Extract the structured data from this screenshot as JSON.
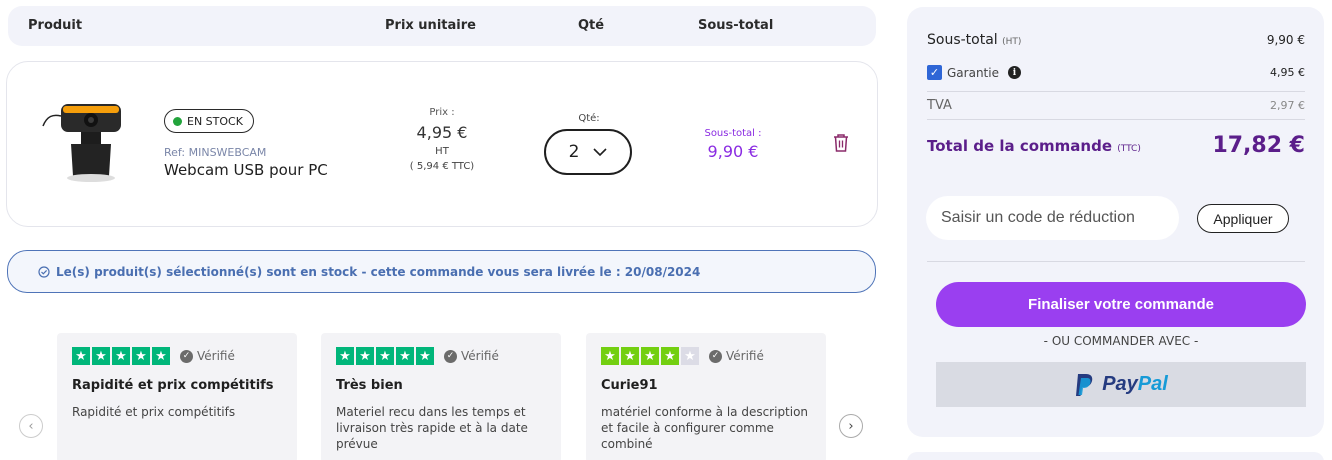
{
  "table_header": {
    "product": "Produit",
    "unit_price": "Prix unitaire",
    "qty": "Qté",
    "subtotal": "Sous-total"
  },
  "product": {
    "stock_badge": "EN STOCK",
    "ref": "Ref: MINSWEBCAM",
    "name": "Webcam USB pour PC",
    "price_label": "Prix :",
    "price": "4,95 €",
    "price_ht": "HT",
    "price_ttc": "( 5,94 € TTC)",
    "qty_label": "Qté:",
    "qty_value": "2",
    "subtotal_label": "Sous-total :",
    "subtotal": "9,90 €",
    "image_icon": "webcam-image",
    "delete_icon": "trash-icon"
  },
  "stock_banner": "Le(s) produit(s) sélectionné(s) sont en stock - cette commande vous sera livrée le : 20/08/2024",
  "reviews": [
    {
      "rating": 5,
      "verified": "Vérifié",
      "title": "Rapidité et prix compétitifs",
      "body": "Rapidité et prix compétitifs"
    },
    {
      "rating": 5,
      "verified": "Vérifié",
      "title": "Très bien",
      "body": "Materiel recu dans les temps et livraison très rapide et à la date prévue"
    },
    {
      "rating": 4,
      "verified": "Vérifié",
      "title": "Curie91",
      "body": "matériel conforme à la description et facile à configurer comme combiné"
    }
  ],
  "summary": {
    "subtotal_label": "Sous-total",
    "subtotal_suffix": "(HT)",
    "subtotal": "9,90 €",
    "warranty_label": "Garantie",
    "warranty_checked": true,
    "warranty": "4,95 €",
    "tva_label": "TVA",
    "tva": "2,97 €",
    "total_label": "Total de la commande",
    "total_suffix": "(TTC)",
    "total": "17,82 €",
    "promo_placeholder": "Saisir un code de réduction",
    "apply_label": "Appliquer",
    "checkout_label": "Finaliser votre commande",
    "or_label": "- OU COMMANDER AVEC -",
    "paypal_pay": "Pay",
    "paypal_pal": "Pal"
  },
  "colors": {
    "accent": "#9a3ff0",
    "total_text": "#5b1e8a",
    "star_green": "#00b67a",
    "star_lime": "#73cf11",
    "banner_blue": "#4a6fb1"
  }
}
